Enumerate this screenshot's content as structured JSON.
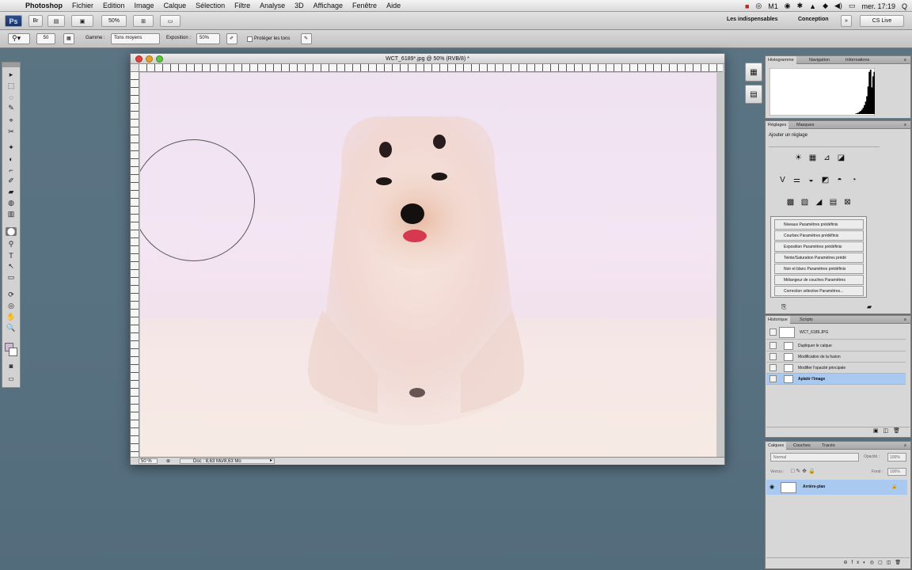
{
  "menubar": {
    "apple": "",
    "items": [
      "Photoshop",
      "Fichier",
      "Edition",
      "Image",
      "Calque",
      "Sélection",
      "Filtre",
      "Analyse",
      "3D",
      "Affichage",
      "Fenêtre",
      "Aide"
    ],
    "status_icons": [
      "■",
      "◎",
      "M1",
      "◉",
      "✱",
      "▲",
      "◆",
      "◀)"
    ],
    "clock": "mer. 17:19",
    "search": "Q",
    "battery": "▭"
  },
  "appbar": {
    "ps_logo": "Ps",
    "zoom": "50%",
    "workspace_essentials": "Les indispensables",
    "workspace_design": "Conception",
    "cslive": "CS Live",
    "layout_icon": "⊞",
    "view_icon": "▣"
  },
  "options": {
    "brush_size": "50",
    "range_label": "Gamme :",
    "range_value": "Tons moyens",
    "exposure_label": "Exposition :",
    "exposure_value": "50%",
    "protect_label": "Protéger les tons"
  },
  "tools": [
    "▸",
    "⬚",
    "◌",
    "✎",
    "⌖",
    "✂",
    "✦",
    "◐",
    "⌐",
    "✐",
    "▰",
    "◍",
    "▥",
    "⬤",
    "⚲",
    "T",
    "↖",
    "▭",
    "✋",
    "🔍"
  ],
  "document": {
    "title": "WCT_6189*.jpg @ 50% (RVB/8) *",
    "zoom": "50 %",
    "doc_info": "Doc : 8,63 Mo/8,63 Mo"
  },
  "histogram_panel": {
    "tabs": [
      "Histogramme",
      "Navigation",
      "Informations"
    ],
    "bars": [
      0,
      0,
      0,
      0,
      0,
      0,
      0,
      0,
      0,
      0,
      0,
      0,
      0,
      0,
      0,
      0,
      0,
      0,
      0,
      0,
      0,
      0,
      0,
      0,
      0,
      0,
      0,
      0,
      0,
      0,
      0,
      0,
      0,
      0,
      0,
      0,
      0,
      0,
      0,
      0,
      0,
      0,
      0,
      0,
      0,
      0,
      0,
      0,
      0,
      0,
      0,
      0,
      0,
      0,
      0,
      0,
      0,
      0,
      0,
      0,
      0,
      0,
      0,
      0,
      0,
      0,
      0,
      0,
      0,
      0,
      0.01,
      0.02,
      0.03,
      0.05,
      0.07,
      0.1,
      0.14,
      0.2,
      0.28,
      0.4,
      0.62,
      0.95,
      1.0,
      0.6,
      0.85,
      0.95
    ]
  },
  "adjustments_panel": {
    "tabs": [
      "Réglages",
      "Masques"
    ],
    "title": "Ajouter un réglage",
    "row1_icons": [
      "☀",
      "▦",
      "⊿",
      "◪"
    ],
    "row2_icons": [
      "V",
      "⚌",
      "◒",
      "◩",
      "◓",
      "◔"
    ],
    "row3_icons": [
      "▩",
      "▧",
      "◢",
      "▤",
      "⊠"
    ],
    "presets": [
      "Niveaux Paramètres prédéfinis",
      "Courbes Paramètres prédéfinis",
      "Exposition Paramètres prédéfinis",
      "Teinte/Saturation Paramètres prédé",
      "Noir et blanc Paramètres prédéfinis",
      "Mélangeur de couches Paramètres",
      "Correction sélective Paramètres..."
    ]
  },
  "history_panel": {
    "tabs": [
      "Historique",
      "Scripts"
    ],
    "snapshot": "WCT_6189.JPG",
    "items": [
      "Dupliquer le calque",
      "Modification de la fusion",
      "Modifier l'opacité principale",
      "Aplatir l'image"
    ],
    "active_index": 3
  },
  "layers_panel": {
    "tabs": [
      "Calques",
      "Couches",
      "Tracés"
    ],
    "blend_mode": "Normal",
    "opacity_label": "Opacité :",
    "opacity_value": "100%",
    "lock_label": "Verrou :",
    "fill_label": "Fond :",
    "fill_value": "100%",
    "layer_name": "Arrière-plan",
    "eye_icon": "◉",
    "lock_icon": "🔒"
  },
  "colors": {
    "selection_blue": "#a9c9f0",
    "foreground_swatch": "#d3b7d9",
    "canvas_bg": "#f1e1ee"
  }
}
